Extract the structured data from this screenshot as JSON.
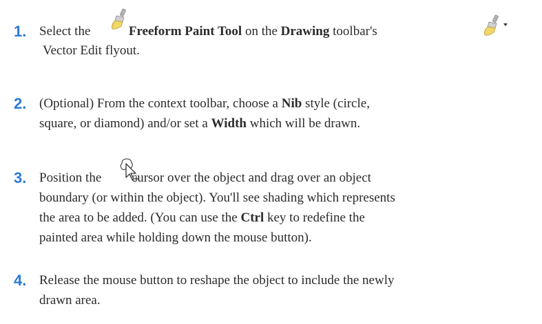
{
  "accent_color": "#2b7bd6",
  "steps": [
    {
      "number": "1.",
      "line1": {
        "t1": "Select the",
        "icon1": "freeform-paint-brush-icon",
        "b1": "Freeform Paint Tool",
        "t2": "on the",
        "b2": "Drawing",
        "t3": "toolbar's",
        "icon2": "vector-edit-flyout-icon"
      },
      "line2": "Vector Edit flyout."
    },
    {
      "number": "2.",
      "line1": {
        "t1": "(Optional) From the context toolbar, choose a",
        "b1": "Nib",
        "t2": "style (circle,"
      },
      "line2": {
        "t1": "square, or diamond) and/or set a",
        "b1": "Width",
        "t2": "which will be drawn."
      }
    },
    {
      "number": "3.",
      "line1": {
        "t1": "Position the",
        "icon": "freeform-paint-cursor-icon",
        "t2": "cursor over the object and drag over an object"
      },
      "line2": "boundary (or within the object). You'll see shading which represents",
      "line3": {
        "t1": "the area to be added. (You can use the",
        "b1": "Ctrl",
        "t2": "key to redefine the"
      },
      "line4": "painted area while holding down the mouse button)."
    },
    {
      "number": "4.",
      "line1": "Release the mouse button to reshape the object to include the newly",
      "line2": "drawn area."
    }
  ]
}
